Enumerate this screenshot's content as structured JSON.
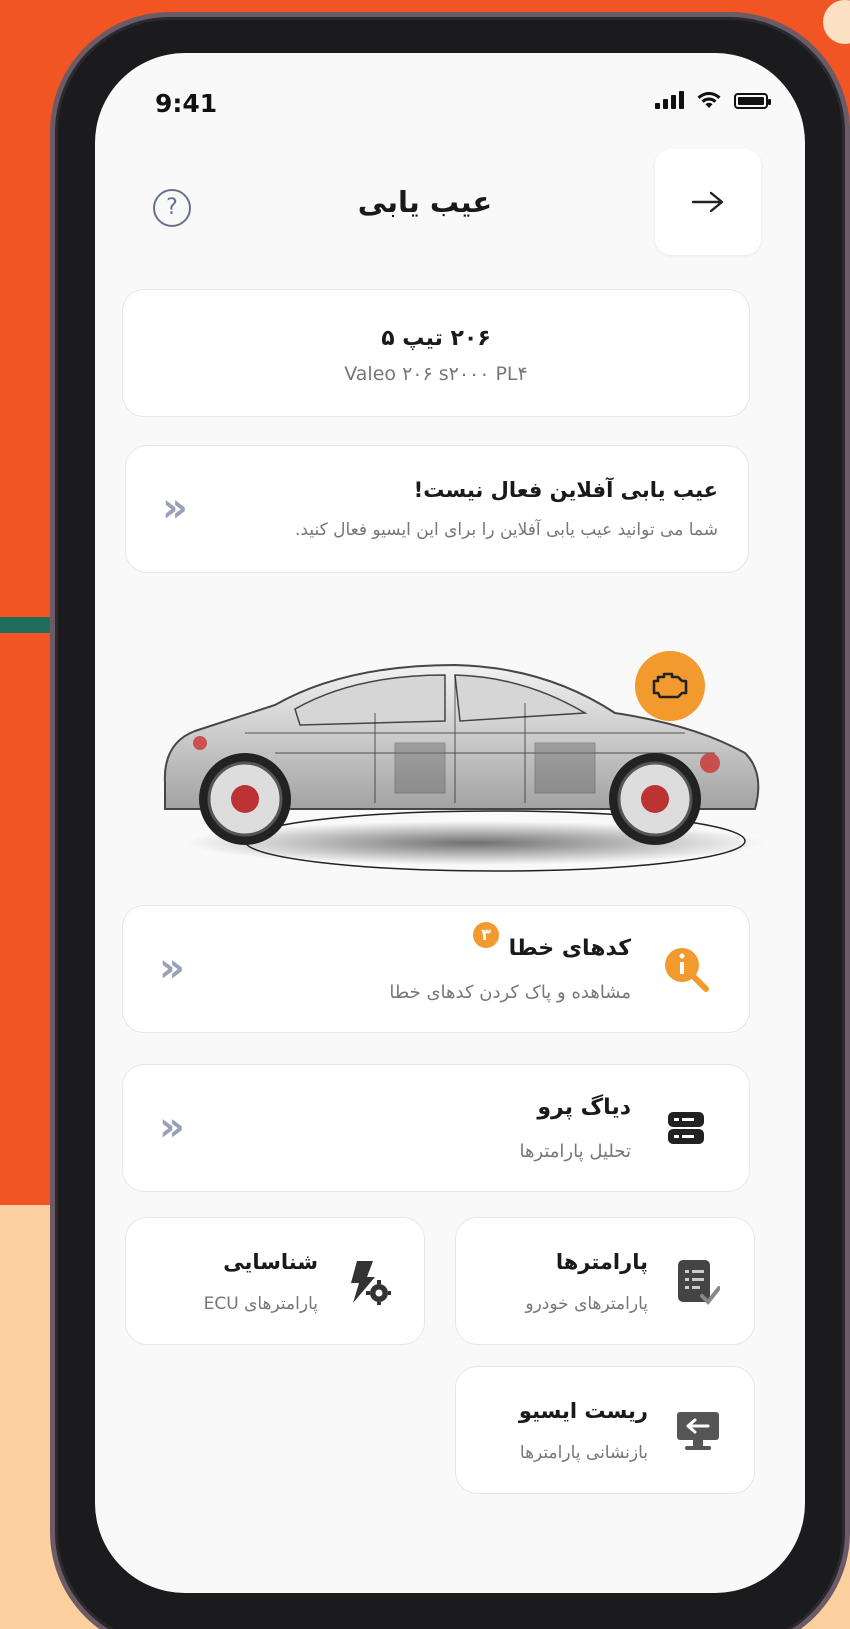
{
  "status_bar": {
    "time": "9:41"
  },
  "header": {
    "title": "عیب یابی",
    "back_icon": "arrow-right-icon",
    "help_icon": "question-circle-icon"
  },
  "vehicle": {
    "name": "۲۰۶ تیپ ۵",
    "ecu": "Valeo ۲۰۶ s۲۰۰۰ PL۴"
  },
  "offline_notice": {
    "title": "عیب یابی آفلاین فعال نیست!",
    "description": "شما می توانید عیب یابی آفلاین را برای این ایسیو فعال کنید."
  },
  "menu": {
    "fault_codes": {
      "title": "کدهای خطا",
      "subtitle": "مشاهده و پاک کردن کدهای خطا",
      "badge": "۳",
      "icon": "search-info-icon"
    },
    "diag_pro": {
      "title": "دیاگ پرو",
      "subtitle": "تحلیل پارامترها",
      "icon": "server-icon"
    },
    "parameters": {
      "title": "پارامترها",
      "subtitle": "پارامترهای خودرو",
      "icon": "checklist-icon"
    },
    "identification": {
      "title": "شناسایی",
      "subtitle": "پارامترهای ECU",
      "icon": "flash-gear-icon"
    },
    "ecu_reset": {
      "title": "ریست ایسیو",
      "subtitle": "بازنشانی پارامترها",
      "icon": "monitor-return-icon"
    }
  },
  "colors": {
    "accent_orange": "#F39A2E",
    "bg_orange": "#F15523",
    "bg_peach": "#FBCF9E",
    "chevron": "#9aa0b8"
  }
}
